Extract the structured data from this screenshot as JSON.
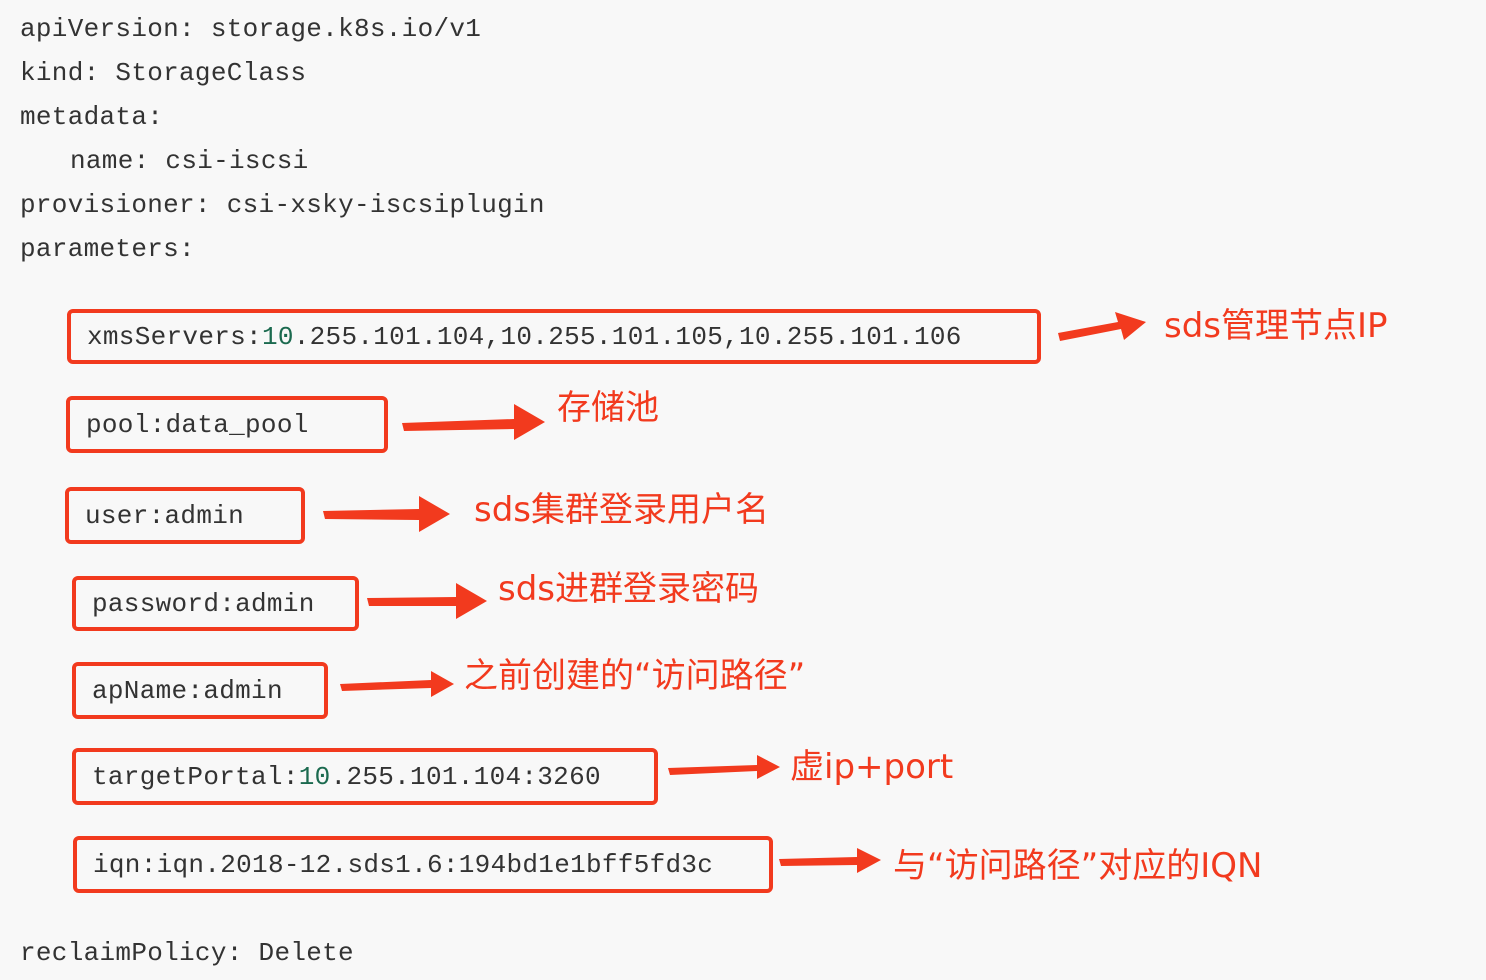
{
  "yaml": {
    "apiVersion_key": "apiVersion:",
    "apiVersion_value": "storage.k8s.io/v1",
    "kind_key": "kind:",
    "kind_value": "StorageClass",
    "metadata_key": "metadata:",
    "name_key": "name:",
    "name_value": "csi-iscsi",
    "provisioner_key": "provisioner:",
    "provisioner_value": "csi-xsky-iscsiplugin",
    "parameters_key": "parameters:",
    "reclaimPolicy_key": "reclaimPolicy:",
    "reclaimPolicy_value": "Delete"
  },
  "parameters": {
    "xmsServers": {
      "key": "xmsServers:",
      "num": "10",
      "rest": ".255.101.104,10.255.101.105,10.255.101.106"
    },
    "pool": {
      "key": "pool:",
      "value": "data_pool"
    },
    "user": {
      "key": "user:",
      "value": "admin"
    },
    "password": {
      "key": "password:",
      "value": "admin"
    },
    "apName": {
      "key": "apName:",
      "value": "admin"
    },
    "targetPortal": {
      "key": "targetPortal:",
      "num": "10",
      "rest": ".255.101.104:3260"
    },
    "iqn": {
      "key": "iqn:",
      "value": "iqn.2018-12.sds1.6:194bd1e1bff5fd3c"
    }
  },
  "annotations": {
    "xmsServers": "sds管理节点IP",
    "pool": "存储池",
    "user": "sds集群登录用户名",
    "password": "sds进群登录密码",
    "apName": "之前创建的“访问路径”",
    "targetPortal": "虚ip+port",
    "iqn": "与“访问路径”对应的IQN"
  },
  "colors": {
    "background": "#f8f8f8",
    "text": "#333333",
    "number": "#1b6a4f",
    "annotation": "#f23a1e"
  }
}
